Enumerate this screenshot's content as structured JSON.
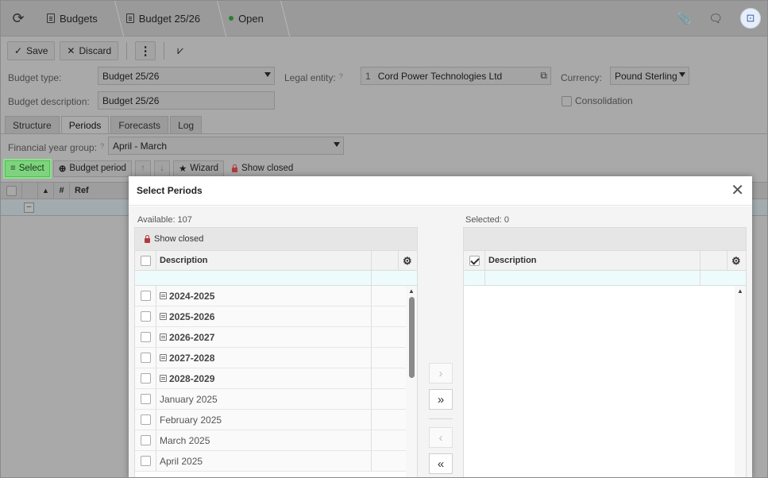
{
  "topbar": {
    "crumbs": [
      "Budgets",
      "Budget 25/26",
      "Open"
    ]
  },
  "toolbar": {
    "save_label": "Save",
    "discard_label": "Discard",
    "more_label": "⋮"
  },
  "form": {
    "budget_type_label": "Budget type:",
    "budget_type_value": "Budget 25/26",
    "legal_entity_label": "Legal entity:",
    "legal_entity_num": "1",
    "legal_entity_value": "Cord Power Technologies Ltd",
    "currency_label": "Currency:",
    "currency_value": "Pound Sterling",
    "budget_desc_label": "Budget description:",
    "budget_desc_value": "Budget 25/26",
    "consolidation_label": "Consolidation",
    "fy_group_label": "Financial year group:",
    "fy_group_value": "April - March",
    "hint_mark": "?"
  },
  "tabs": [
    "Structure",
    "Periods",
    "Forecasts",
    "Log"
  ],
  "period_toolbar": {
    "select_label": "Select",
    "budget_period_label": "Budget period",
    "wizard_label": "Wizard",
    "show_closed_label": "Show closed"
  },
  "bg_grid": {
    "sort_col": "▲",
    "num_col": "#",
    "ref_col": "Ref"
  },
  "modal": {
    "title": "Select Periods",
    "available_label": "Available: 107",
    "selected_label": "Selected: 0",
    "show_closed_label": "Show closed",
    "description_header": "Description",
    "available_rows": [
      {
        "label": "2024-2025",
        "group": true
      },
      {
        "label": "2025-2026",
        "group": true
      },
      {
        "label": "2026-2027",
        "group": true
      },
      {
        "label": "2027-2028",
        "group": true
      },
      {
        "label": "2028-2029",
        "group": true
      },
      {
        "label": "January 2025",
        "group": false
      },
      {
        "label": "February 2025",
        "group": false
      },
      {
        "label": "March 2025",
        "group": false
      },
      {
        "label": "April 2025",
        "group": false
      }
    ],
    "move_right": "›",
    "move_all_right": "»",
    "move_left": "‹",
    "move_all_left": "«"
  },
  "colors": {
    "select_green": "#7fd37f",
    "open_status": "#2e7d32",
    "overlay_grey": "#a9a9a9"
  }
}
